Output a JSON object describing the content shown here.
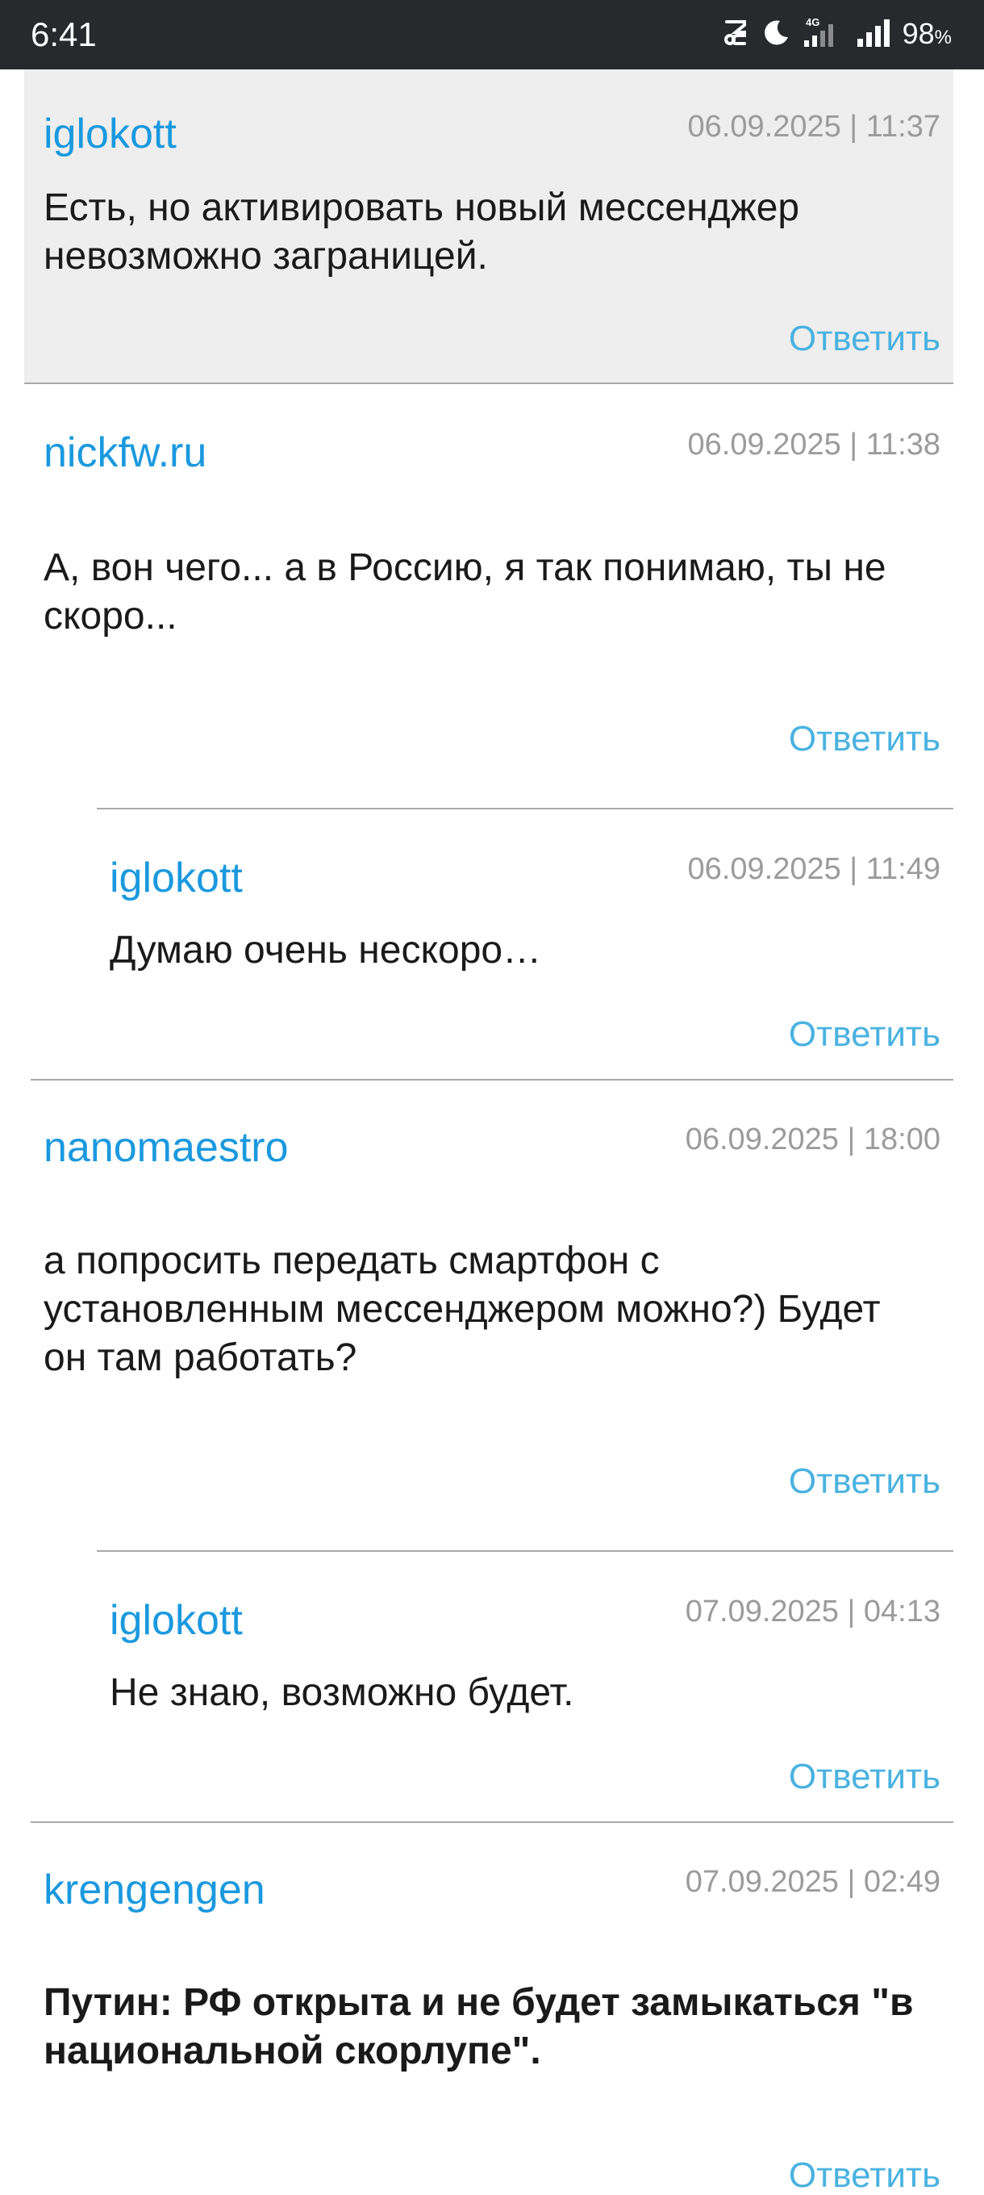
{
  "status_bar": {
    "time": "6:41",
    "network": "4G",
    "battery_level": "98",
    "battery_unit": "%",
    "icons": [
      "notification-icon",
      "do-not-disturb-moon-icon",
      "signal-4g-icon",
      "signal-icon"
    ]
  },
  "colors": {
    "author": "#1a99de",
    "reply": "#49b2e0",
    "timestamp": "#9b9b9b",
    "highlight_bg": "#eeeeee",
    "divider": "#a9a9a9"
  },
  "comments": [
    {
      "author": "iglokott",
      "timestamp": "06.09.2025 | 11:37",
      "text": "Есть, но активировать новый мессенджер невозможно заграницей.",
      "reply_label": "Ответить"
    },
    {
      "author": "nickfw.ru",
      "timestamp": "06.09.2025 | 11:38",
      "text": "А, вон чего... а в Россию, я так понимаю, ты не скоро...",
      "reply_label": "Ответить"
    },
    {
      "author": "iglokott",
      "timestamp": "06.09.2025 | 11:49",
      "text": "Думаю очень нескоро…",
      "reply_label": "Ответить"
    },
    {
      "author": "nanomaestro",
      "timestamp": "06.09.2025 | 18:00",
      "text": "а попросить передать смартфон с установленным мессенджером можно?) Будет он там работать?",
      "reply_label": "Ответить"
    },
    {
      "author": "iglokott",
      "timestamp": "07.09.2025 | 04:13",
      "text": "Не знаю, возможно будет.",
      "reply_label": "Ответить"
    },
    {
      "author": "krengengen",
      "timestamp": "07.09.2025 | 02:49",
      "text": "Путин: РФ открыта и не будет замыкаться \"в национальной скорлупе\".",
      "reply_label": "Ответить"
    }
  ]
}
